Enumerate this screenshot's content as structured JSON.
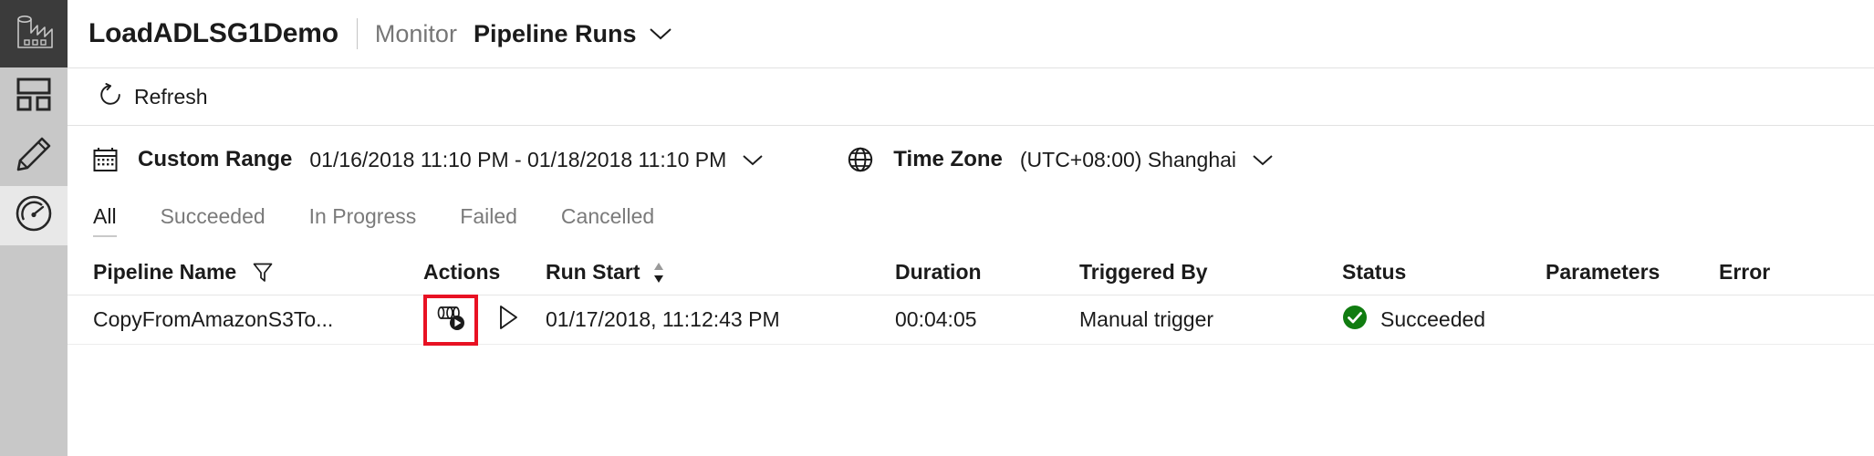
{
  "app": {
    "logo_icon": "factory-icon"
  },
  "sidebar": {
    "items": [
      {
        "icon": "dashboard-icon",
        "name": "overview",
        "selected": false
      },
      {
        "icon": "pencil-icon",
        "name": "author",
        "selected": false
      },
      {
        "icon": "gauge-icon",
        "name": "monitor",
        "selected": true
      }
    ]
  },
  "header": {
    "title": "LoadADLSG1Demo",
    "breadcrumb_parent": "Monitor",
    "breadcrumb_current": "Pipeline Runs",
    "chevron_icon": "chevron-down-icon"
  },
  "toolbar": {
    "refresh_label": "Refresh",
    "refresh_icon": "refresh-icon"
  },
  "filters": {
    "range": {
      "icon": "calendar-icon",
      "label": "Custom Range",
      "value": "01/16/2018 11:10 PM - 01/18/2018 11:10 PM",
      "chevron_icon": "chevron-down-icon"
    },
    "timezone": {
      "icon": "globe-icon",
      "label": "Time Zone",
      "value": "(UTC+08:00) Shanghai",
      "chevron_icon": "chevron-down-icon"
    }
  },
  "tabs": [
    {
      "label": "All",
      "active": true
    },
    {
      "label": "Succeeded",
      "active": false
    },
    {
      "label": "In Progress",
      "active": false
    },
    {
      "label": "Failed",
      "active": false
    },
    {
      "label": "Cancelled",
      "active": false
    }
  ],
  "table": {
    "columns": [
      {
        "label": "Pipeline Name",
        "icon": "filter-funnel-icon"
      },
      {
        "label": "Actions",
        "icon": ""
      },
      {
        "label": "Run Start",
        "icon": "sort-arrows-icon"
      },
      {
        "label": "Duration",
        "icon": ""
      },
      {
        "label": "Triggered By",
        "icon": ""
      },
      {
        "label": "Status",
        "icon": ""
      },
      {
        "label": "Parameters",
        "icon": ""
      },
      {
        "label": "Error",
        "icon": ""
      }
    ],
    "rows": [
      {
        "pipeline_name": "CopyFromAmazonS3To...",
        "action_view_icon": "view-activity-runs-icon",
        "action_rerun_icon": "play-icon",
        "run_start": "01/17/2018, 11:12:43 PM",
        "duration": "00:04:05",
        "triggered_by": "Manual trigger",
        "status_icon": "success-check-icon",
        "status": "Succeeded",
        "parameters": "",
        "error": ""
      }
    ]
  },
  "colors": {
    "highlight": "#E81123",
    "success": "#107C10",
    "rail": "#C8C8C8",
    "rail_selected": "#E8E8E8",
    "logo_bg": "#3B3B3B"
  }
}
